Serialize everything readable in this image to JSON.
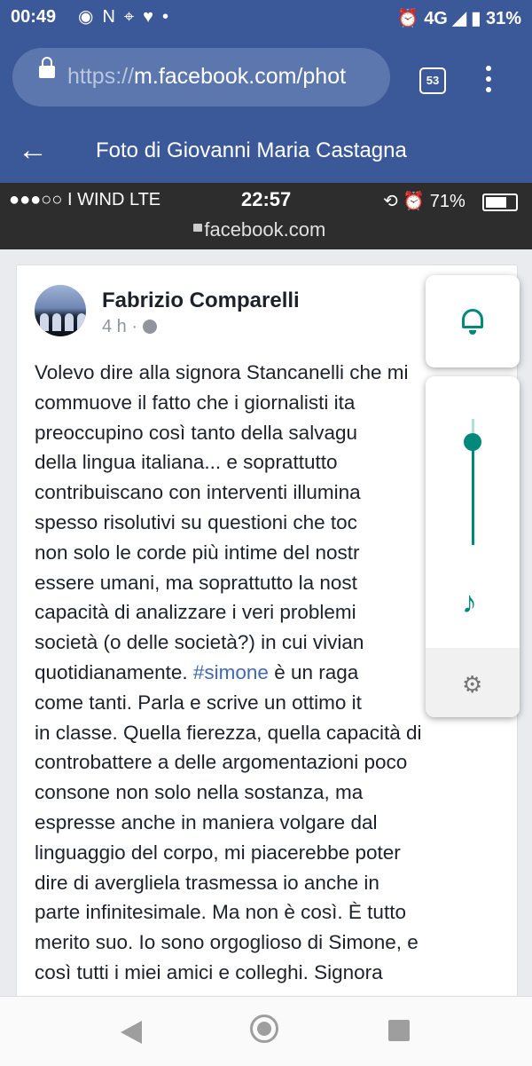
{
  "status_bar": {
    "time": "00:49",
    "left_icons": [
      "messenger-icon",
      "n-icon",
      "location-icon",
      "heart-icon",
      "dot-icon"
    ],
    "network": "4G",
    "battery": "31%"
  },
  "browser": {
    "url_prefix": "https://",
    "url_host": "m.facebook.com/phot",
    "tab_count": "53"
  },
  "fb_header": {
    "title": "Foto di Giovanni Maria Castagna"
  },
  "embedded_status": {
    "carrier": "●●●○○ I WIND   LTE",
    "time": "22:57",
    "battery": "71%",
    "battery_level": 0.71,
    "domain": "facebook.com"
  },
  "post": {
    "author": "Fabrizio Comparelli",
    "time": "4 h ·",
    "text_before_tag": "Volevo dire alla signora Stancanelli che mi\ncommuove il fatto che i giornalisti ita\npreoccupino così tanto della salvagu\ndella lingua italiana... e soprattutto\ncontribuiscano con interventi illumina\nspesso risolutivi su questioni che toc\nnon solo le corde più intime del nostr\nessere umani, ma soprattutto la nost\ncapacità di analizzare i veri problemi\nsocietà (o delle società?) in cui vivian\nquotidianamente. ",
    "hashtag": "#simone",
    "text_after_tag": " è un raga\ncome tanti. Parla e scrive un ottimo it\nin classe. Quella fierezza, quella capacità di\ncontrobattere a delle argomentazioni poco\nconsone non solo nella sostanza, ma\nespresse anche in maniera volgare dal\nlinguaggio del corpo, mi piacerebbe poter\ndire di avergliela trasmessa io anche in\nparte infinitesimale. Ma non è così. È tutto\nmerito suo. Io sono orgoglioso di Simone, e\ncosì tutti i miei amici e colleghi. Signora"
  },
  "volume_panel": {
    "ring_icon": "bell-icon",
    "media_icon": "music-note-icon",
    "settings_icon": "gear-icon",
    "level": 0.82,
    "accent": "#00897b"
  },
  "colors": {
    "facebook_blue": "#3b5998",
    "link": "#4267b2"
  }
}
